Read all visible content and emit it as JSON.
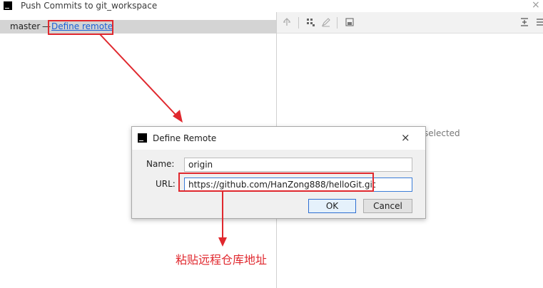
{
  "window": {
    "title": "Push Commits to git_workspace",
    "close_glyph": "×"
  },
  "branch": {
    "name": "master",
    "separator": "—",
    "define_link": "Define remote"
  },
  "right_pane": {
    "empty_text": "selected"
  },
  "dialog": {
    "title": "Define Remote",
    "close_glyph": "×",
    "name_label": "Name:",
    "name_value": "origin",
    "url_label": "URL:",
    "url_value": "https://github.com/HanZong888/helloGit.git",
    "ok_label": "OK",
    "cancel_label": "Cancel"
  },
  "annotation": {
    "text": "粘贴远程仓库地址",
    "color": "#e0282e"
  },
  "icons": [
    "app-logo-icon",
    "close-icon",
    "pin-icon",
    "grid-icon",
    "edit-icon",
    "save-icon",
    "expand-all-icon",
    "collapse-icon"
  ],
  "colors": {
    "accent": "#2f6fd2",
    "link": "#1a5fd6",
    "highlight": "#e0282e",
    "branch_row": "#d4d4d4"
  }
}
